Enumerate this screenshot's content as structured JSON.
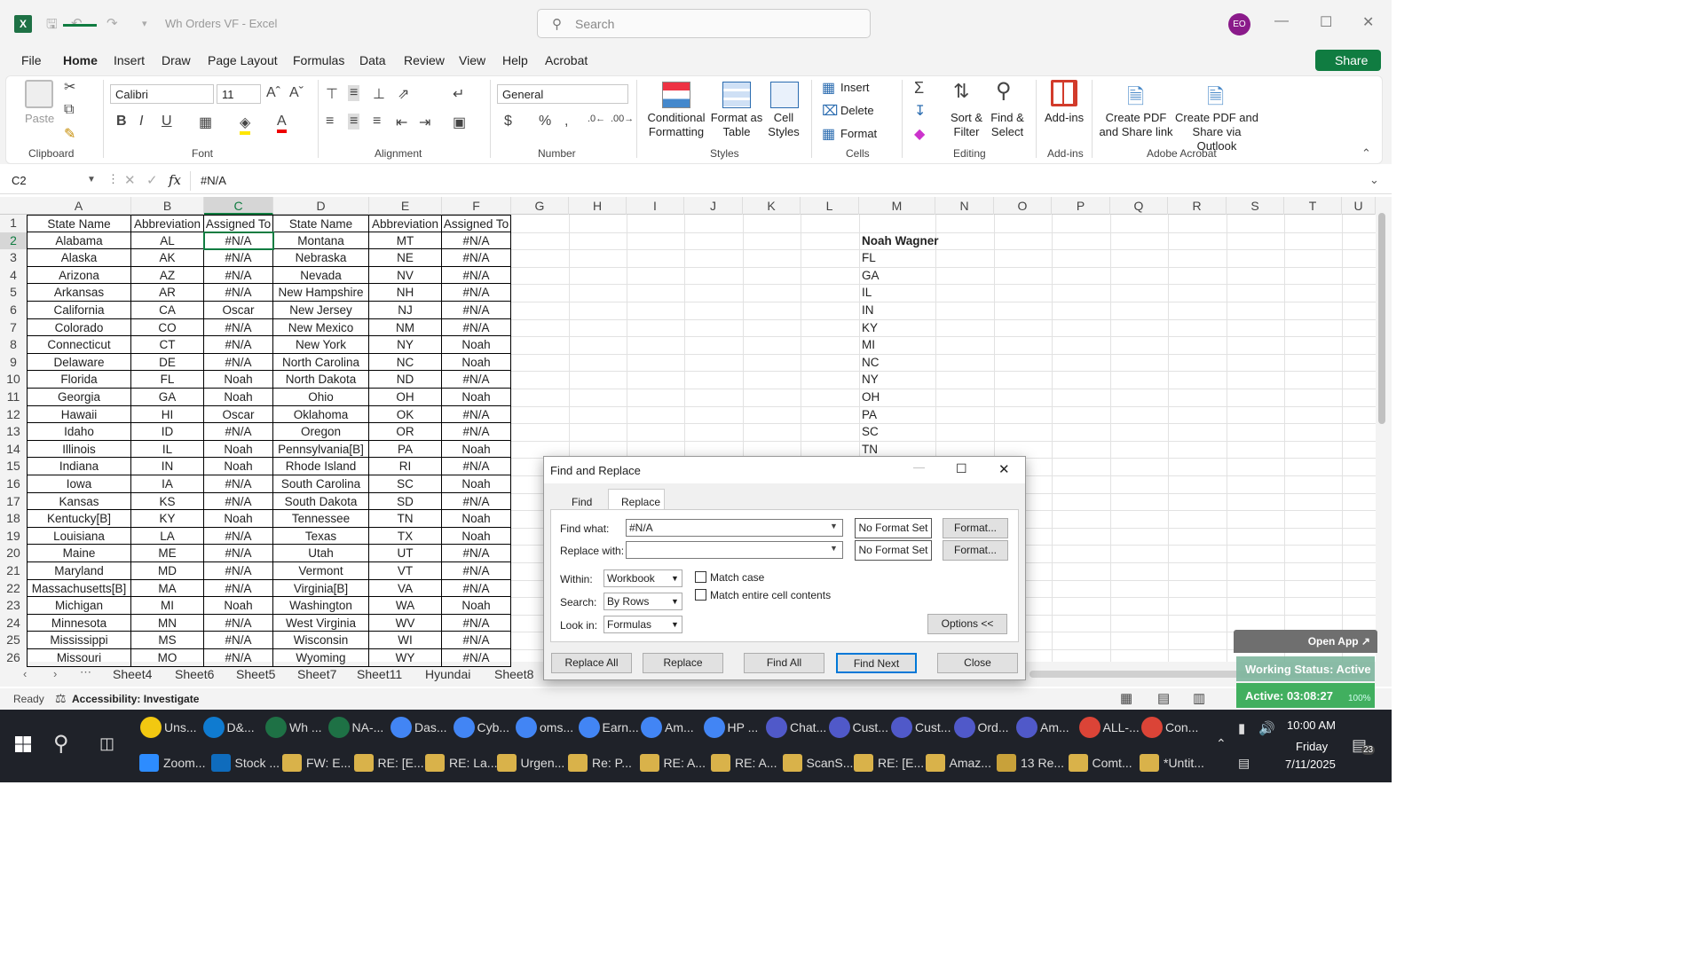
{
  "window": {
    "title": "Wh Orders VF  -  Excel",
    "search_placeholder": "Search",
    "avatar": "EO"
  },
  "menu": [
    "File",
    "Home",
    "Insert",
    "Draw",
    "Page Layout",
    "Formulas",
    "Data",
    "Review",
    "View",
    "Help",
    "Acrobat"
  ],
  "share": "Share",
  "ribbon": {
    "paste": "Paste",
    "font_name": "Calibri",
    "font_size": "11",
    "number_format": "General",
    "conditional": [
      "Conditional",
      "Formatting"
    ],
    "format_table": [
      "Format as",
      "Table"
    ],
    "cell_styles": [
      "Cell",
      "Styles"
    ],
    "insert": "Insert",
    "delete": "Delete",
    "format": "Format",
    "sort": [
      "Sort &",
      "Filter"
    ],
    "find": [
      "Find &",
      "Select"
    ],
    "addins": "Add-ins",
    "pdf_link": [
      "Create PDF",
      "and Share link"
    ],
    "pdf_outlook": [
      "Create PDF and",
      "Share via Outlook"
    ],
    "groups": [
      "Clipboard",
      "Font",
      "Alignment",
      "Number",
      "Styles",
      "Cells",
      "Editing",
      "Add-ins",
      "Adobe Acrobat"
    ]
  },
  "formula_bar": {
    "name_box": "C2",
    "formula": "#N/A",
    "fx": "fx"
  },
  "columns": [
    "A",
    "B",
    "C",
    "D",
    "E",
    "F",
    "G",
    "H",
    "I",
    "J",
    "K",
    "L",
    "M",
    "N",
    "O",
    "P",
    "Q",
    "R",
    "S",
    "T",
    "U"
  ],
  "rows": [
    [
      "State Name",
      "Abbreviation",
      "Assigned To",
      "State Name",
      "Abbreviation",
      "Assigned To",
      ""
    ],
    [
      "Alabama",
      "AL",
      "#N/A",
      "Montana",
      "MT",
      "#N/A",
      "Noah Wagner"
    ],
    [
      "Alaska",
      "AK",
      "#N/A",
      "Nebraska",
      "NE",
      "#N/A",
      "FL"
    ],
    [
      "Arizona",
      "AZ",
      "#N/A",
      "Nevada",
      "NV",
      "#N/A",
      "GA"
    ],
    [
      "Arkansas",
      "AR",
      "#N/A",
      "New Hampshire",
      "NH",
      "#N/A",
      "IL"
    ],
    [
      "California",
      "CA",
      "Oscar",
      "New Jersey",
      "NJ",
      "#N/A",
      "IN"
    ],
    [
      "Colorado",
      "CO",
      "#N/A",
      "New Mexico",
      "NM",
      "#N/A",
      "KY"
    ],
    [
      "Connecticut",
      "CT",
      "#N/A",
      "New York",
      "NY",
      "Noah",
      "MI"
    ],
    [
      "Delaware",
      "DE",
      "#N/A",
      "North Carolina",
      "NC",
      "Noah",
      "NC"
    ],
    [
      "Florida",
      "FL",
      "Noah",
      "North Dakota",
      "ND",
      "#N/A",
      "NY"
    ],
    [
      "Georgia",
      "GA",
      "Noah",
      "Ohio",
      "OH",
      "Noah",
      "OH"
    ],
    [
      "Hawaii",
      "HI",
      "Oscar",
      "Oklahoma",
      "OK",
      "#N/A",
      "PA"
    ],
    [
      "Idaho",
      "ID",
      "#N/A",
      "Oregon",
      "OR",
      "#N/A",
      "SC"
    ],
    [
      "Illinois",
      "IL",
      "Noah",
      "Pennsylvania[B]",
      "PA",
      "Noah",
      "TN"
    ],
    [
      "Indiana",
      "IN",
      "Noah",
      "Rhode Island",
      "RI",
      "#N/A",
      ""
    ],
    [
      "Iowa",
      "IA",
      "#N/A",
      "South Carolina",
      "SC",
      "Noah",
      ""
    ],
    [
      "Kansas",
      "KS",
      "#N/A",
      "South Dakota",
      "SD",
      "#N/A",
      ""
    ],
    [
      "Kentucky[B]",
      "KY",
      "Noah",
      "Tennessee",
      "TN",
      "Noah",
      ""
    ],
    [
      "Louisiana",
      "LA",
      "#N/A",
      "Texas",
      "TX",
      "Noah",
      ""
    ],
    [
      "Maine",
      "ME",
      "#N/A",
      "Utah",
      "UT",
      "#N/A",
      ""
    ],
    [
      "Maryland",
      "MD",
      "#N/A",
      "Vermont",
      "VT",
      "#N/A",
      ""
    ],
    [
      "Massachusetts[B]",
      "MA",
      "#N/A",
      "Virginia[B]",
      "VA",
      "#N/A",
      ""
    ],
    [
      "Michigan",
      "MI",
      "Noah",
      "Washington",
      "WA",
      "Noah",
      ""
    ],
    [
      "Minnesota",
      "MN",
      "#N/A",
      "West Virginia",
      "WV",
      "#N/A",
      ""
    ],
    [
      "Mississippi",
      "MS",
      "#N/A",
      "Wisconsin",
      "WI",
      "#N/A",
      ""
    ],
    [
      "Missouri",
      "MO",
      "#N/A",
      "Wyoming",
      "WY",
      "#N/A",
      ""
    ]
  ],
  "sheet_tabs": [
    "Sheet4",
    "Sheet6",
    "Sheet5",
    "Sheet7",
    "Sheet11",
    "Hyundai",
    "Sheet8"
  ],
  "status": {
    "ready": "Ready",
    "accessibility": "Accessibility: Investigate"
  },
  "overlay": {
    "open_app": "Open App ↗",
    "working": "Working Status: Active",
    "active": "Active: 03:08:27",
    "zoom": "100%"
  },
  "dialog": {
    "title": "Find and Replace",
    "tabs": [
      "Find",
      "Replace"
    ],
    "find_label": "Find what:",
    "find_value": "#N/A",
    "replace_label": "Replace with:",
    "replace_value": "",
    "no_format": "No Format Set",
    "format_btn": "Format...",
    "within_label": "Within:",
    "within_value": "Workbook",
    "search_label": "Search:",
    "search_value": "By Rows",
    "lookin_label": "Look in:",
    "lookin_value": "Formulas",
    "match_case": "Match case",
    "match_entire": "Match entire cell contents",
    "options": "Options <<",
    "buttons": [
      "Replace All",
      "Replace",
      "Find All",
      "Find Next",
      "Close"
    ]
  },
  "taskbar": {
    "row1": [
      "Uns...",
      "D&...",
      "Wh ...",
      "NA-...",
      "Das...",
      "Cyb...",
      "oms...",
      "Earn...",
      "Am...",
      "HP ...",
      "Chat...",
      "Cust...",
      "Cust...",
      "Ord...",
      "Am...",
      "ALL-...",
      "Con..."
    ],
    "row2": [
      "Zoom...",
      "Stock ...",
      "FW: E...",
      "RE: [E...",
      "RE: La...",
      "Urgen...",
      "Re: P...",
      "RE: A...",
      "RE: A...",
      "ScanS...",
      "RE: [E...",
      "Amaz...",
      "13 Re...",
      "Comt...",
      "*Untit..."
    ],
    "time": "10:00 AM",
    "day": "Friday",
    "date": "7/11/2025",
    "notif": "23"
  },
  "colors": {
    "excel_green": "#107c41",
    "dialog_bg": "#f0f0f0",
    "taskbar": "#1f2229"
  }
}
